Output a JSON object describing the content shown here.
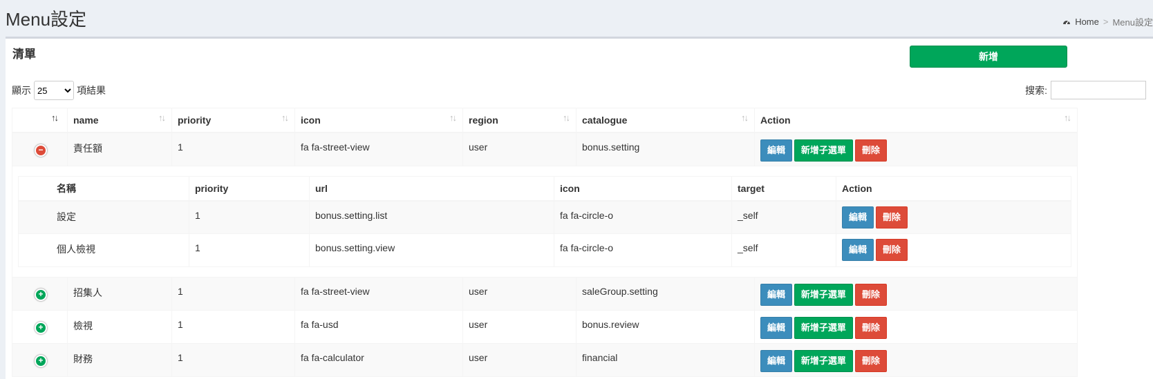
{
  "header": {
    "title": "Menu設定",
    "breadcrumb": {
      "home": "Home",
      "separator": ">",
      "current": "Menu設定"
    }
  },
  "box": {
    "title": "清單",
    "add_label": "新增",
    "length_prefix": "顯示",
    "length_value": "25",
    "length_suffix": "項結果",
    "search_label": "搜索:",
    "search_value": ""
  },
  "table": {
    "columns": [
      "",
      "name",
      "priority",
      "icon",
      "region",
      "catalogue",
      "Action"
    ],
    "actions": {
      "edit": "編輯",
      "add_child": "新增子選單",
      "delete": "刪除"
    },
    "rows": [
      {
        "name": "責任額",
        "priority": "1",
        "icon": "fa fa-street-view",
        "region": "user",
        "catalogue": "bonus.setting",
        "expanded": true
      },
      {
        "name": "招集人",
        "priority": "1",
        "icon": "fa fa-street-view",
        "region": "user",
        "catalogue": "saleGroup.setting",
        "expanded": false
      },
      {
        "name": "檢視",
        "priority": "1",
        "icon": "fa fa-usd",
        "region": "user",
        "catalogue": "bonus.review",
        "expanded": false
      },
      {
        "name": "財務",
        "priority": "1",
        "icon": "fa fa-calculator",
        "region": "user",
        "catalogue": "financial",
        "expanded": false
      }
    ]
  },
  "child_table": {
    "columns": [
      "名稱",
      "priority",
      "url",
      "icon",
      "target",
      "Action"
    ],
    "actions": {
      "edit": "編輯",
      "delete": "刪除"
    },
    "rows": [
      {
        "name": "設定",
        "priority": "1",
        "url": "bonus.setting.list",
        "icon": "fa fa-circle-o",
        "target": "_self"
      },
      {
        "name": "個人檢視",
        "priority": "1",
        "url": "bonus.setting.view",
        "icon": "fa fa-circle-o",
        "target": "_self"
      }
    ]
  },
  "colors": {
    "success": "#00a65a",
    "primary": "#3c8dbc",
    "danger": "#dd4b39"
  }
}
